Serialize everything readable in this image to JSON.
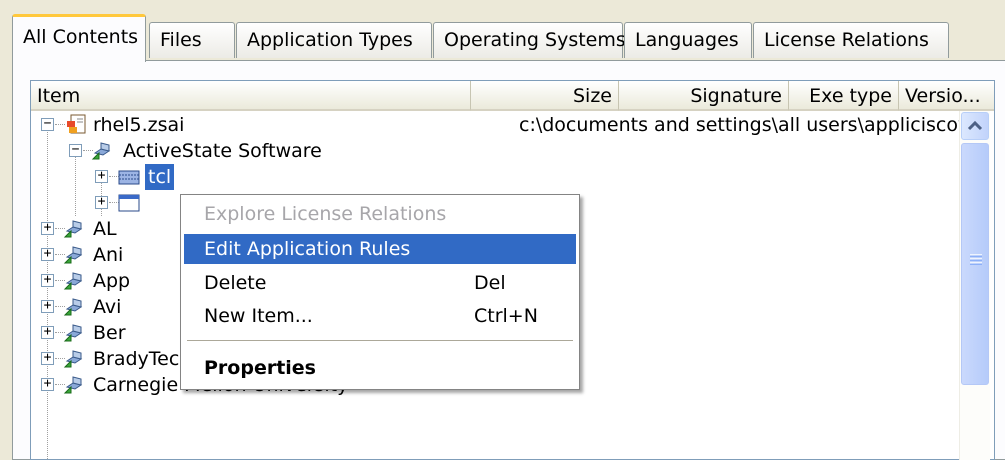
{
  "tabs": [
    {
      "label": "All Contents",
      "active": true
    },
    {
      "label": "Files"
    },
    {
      "label": "Application Types"
    },
    {
      "label": "Operating Systems"
    },
    {
      "label": "Languages"
    },
    {
      "label": "License Relations"
    }
  ],
  "columns": {
    "item": "Item",
    "size": "Size",
    "signature": "Signature",
    "exe_type": "Exe type",
    "version": "Versio..."
  },
  "tree": {
    "root_label": "rhel5.zsai",
    "root_path": "c:\\documents and settings\\all users\\appliciscove",
    "activestate": "ActiveState Software",
    "tcl_selected": "tcl",
    "partial_1": "AL",
    "partial_2": "Ani",
    "partial_3": "App",
    "partial_4": "Avi",
    "partial_5": "Ber",
    "bradytech": "BradyTech",
    "carnegie": "Carnegie Mellon University"
  },
  "context_menu": {
    "explore": "Explore License Relations",
    "edit_rules": "Edit Application Rules",
    "delete": "Delete",
    "delete_shortcut": "Del",
    "new_item": "New Item...",
    "new_item_shortcut": "Ctrl+N",
    "properties": "Properties"
  },
  "colors": {
    "selection": "#316ac5",
    "tab_highlight": "#ffc83c",
    "disabled_text": "#a7a6aa"
  },
  "icons": {
    "root": "zsai-file-icon",
    "vendor": "vendor-package-icon",
    "app": "application-icon",
    "window": "window-icon"
  }
}
